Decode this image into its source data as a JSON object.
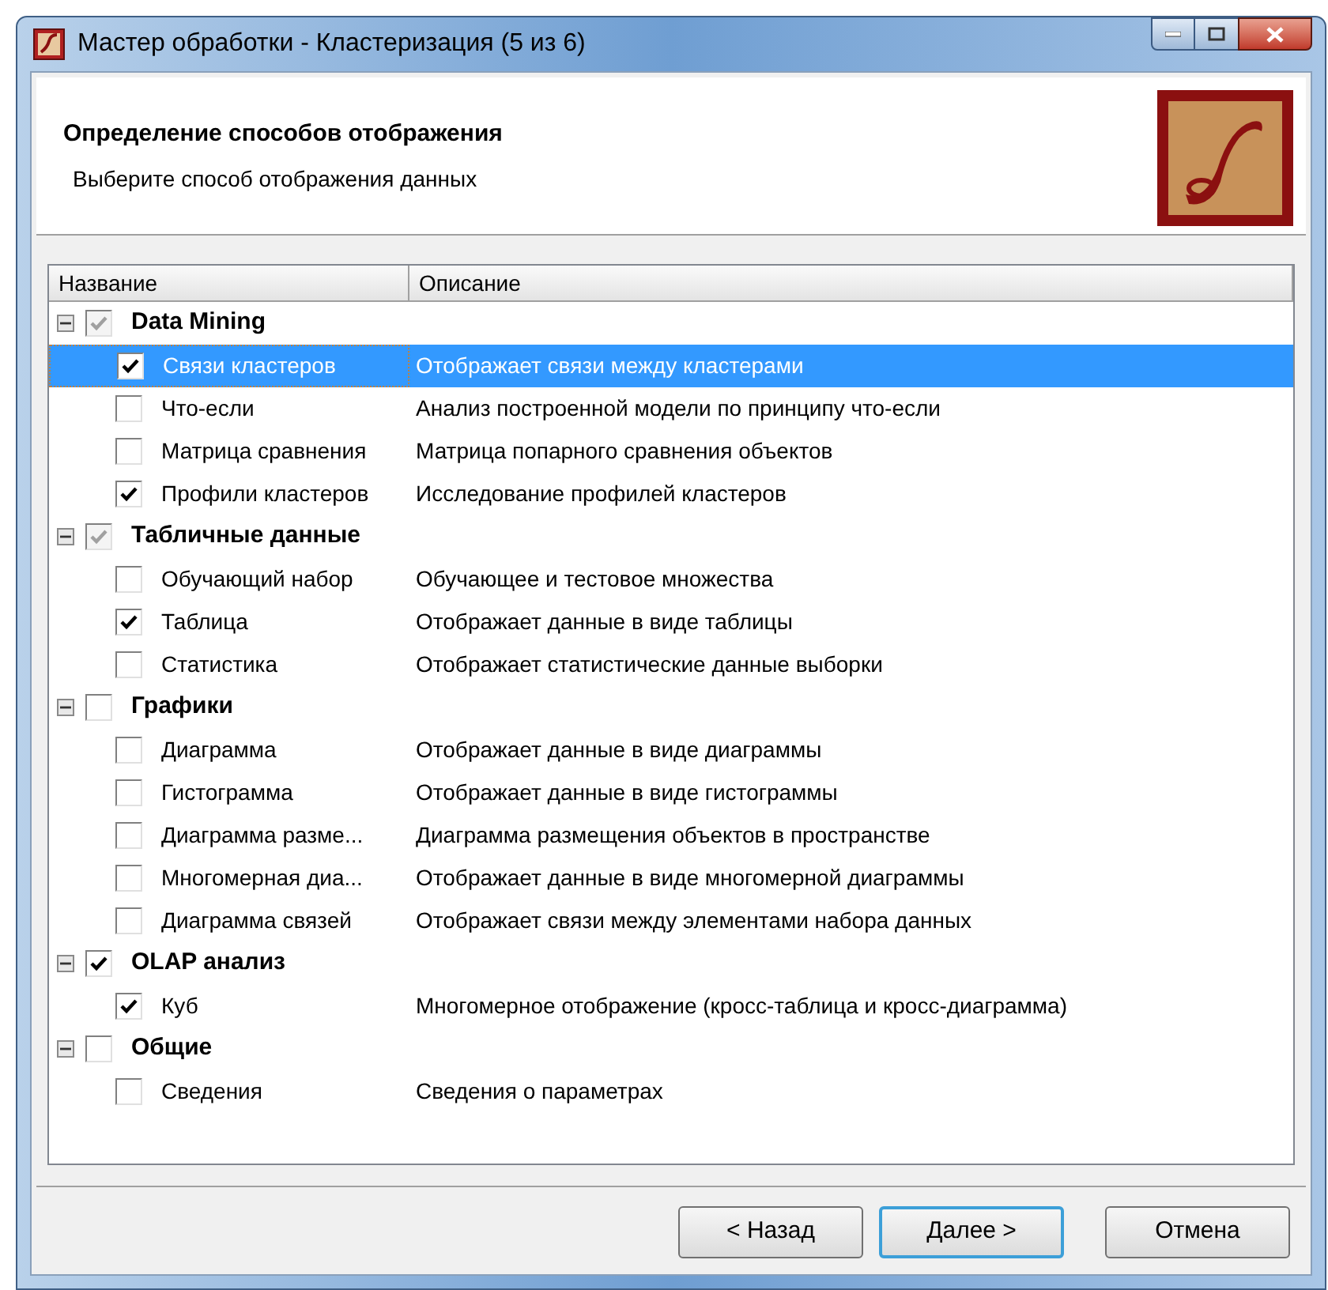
{
  "window": {
    "title": "Мастер обработки - Кластеризация (5 из 6)"
  },
  "header": {
    "title": "Определение способов отображения",
    "subtitle": "Выберите способ отображения данных"
  },
  "table": {
    "columns": [
      "Название",
      "Описание"
    ],
    "groups": [
      {
        "name": "Data Mining",
        "expanded": true,
        "checked": true,
        "partial": true,
        "children": [
          {
            "name": "Связи кластеров",
            "description": "Отображает связи между кластерами",
            "checked": true,
            "selected": true
          },
          {
            "name": "Что-если",
            "description": "Анализ построенной модели по принципу что-если",
            "checked": false,
            "selected": false
          },
          {
            "name": "Матрица сравнения",
            "description": "Матрица попарного сравнения объектов",
            "checked": false,
            "selected": false
          },
          {
            "name": "Профили кластеров",
            "description": "Исследование профилей кластеров",
            "checked": true,
            "selected": false
          }
        ]
      },
      {
        "name": "Табличные данные",
        "expanded": true,
        "checked": true,
        "partial": true,
        "children": [
          {
            "name": "Обучающий набор",
            "description": "Обучающее и тестовое множества",
            "checked": false,
            "selected": false
          },
          {
            "name": "Таблица",
            "description": "Отображает данные в виде таблицы",
            "checked": true,
            "selected": false
          },
          {
            "name": "Статистика",
            "description": "Отображает статистические данные выборки",
            "checked": false,
            "selected": false
          }
        ]
      },
      {
        "name": "Графики",
        "expanded": true,
        "checked": false,
        "partial": false,
        "children": [
          {
            "name": "Диаграмма",
            "description": "Отображает данные в виде диаграммы",
            "checked": false,
            "selected": false
          },
          {
            "name": "Гистограмма",
            "description": "Отображает данные в виде гистограммы",
            "checked": false,
            "selected": false
          },
          {
            "name": "Диаграмма разме...",
            "description": "Диаграмма размещения объектов в пространстве",
            "checked": false,
            "selected": false
          },
          {
            "name": "Многомерная диа...",
            "description": "Отображает данные в виде многомерной диаграммы",
            "checked": false,
            "selected": false
          },
          {
            "name": "Диаграмма связей",
            "description": "Отображает связи между элементами набора данных",
            "checked": false,
            "selected": false
          }
        ]
      },
      {
        "name": "OLAP анализ",
        "expanded": true,
        "checked": true,
        "partial": false,
        "children": [
          {
            "name": "Куб",
            "description": "Многомерное отображение (кросс-таблица и кросс-диаграмма)",
            "checked": true,
            "selected": false
          }
        ]
      },
      {
        "name": "Общие",
        "expanded": true,
        "checked": false,
        "partial": false,
        "children": [
          {
            "name": "Сведения",
            "description": "Сведения о параметрах",
            "checked": false,
            "selected": false
          }
        ]
      }
    ]
  },
  "buttons": [
    {
      "label": "< Назад",
      "selected": false
    },
    {
      "label": "Далее >",
      "selected": true
    },
    {
      "label": "Отмена",
      "selected": false
    }
  ]
}
